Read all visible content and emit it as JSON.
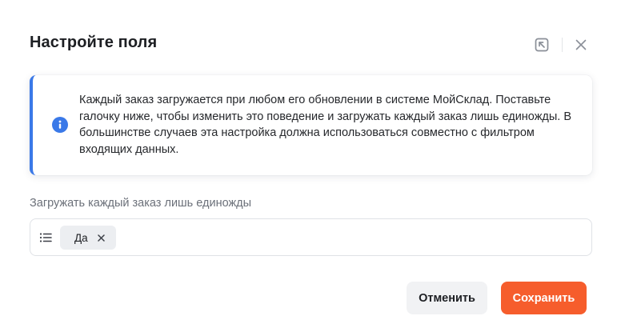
{
  "dialog": {
    "title": "Настройте поля"
  },
  "info": {
    "text": "Каждый заказ загружается при любом его обновлении в системе МойСклад. Поставьте галочку ниже, чтобы изменить это поведение и загружать каждый заказ лишь единожды. В большинстве случаев эта настройка должна использоваться совместно с фильтром входящих данных.",
    "icon": "info-icon",
    "accent_color": "#3a79e8"
  },
  "field": {
    "label": "Загружать каждый заказ лишь единожды",
    "selected_value": "Да"
  },
  "buttons": {
    "cancel_label": "Отменить",
    "save_label": "Сохранить",
    "save_color": "#f65d2c"
  }
}
